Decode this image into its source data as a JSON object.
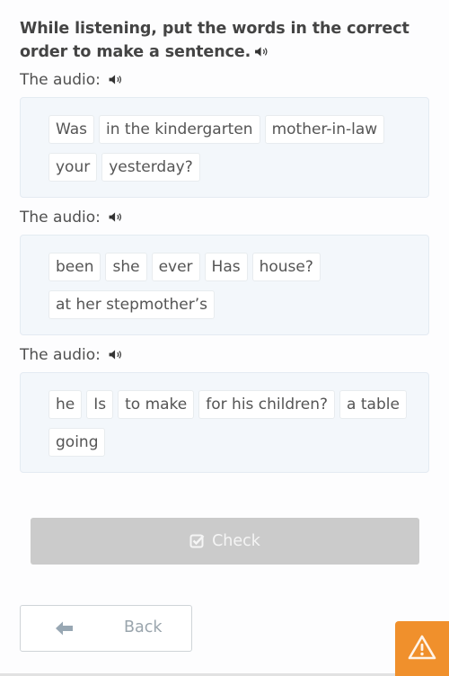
{
  "instruction": {
    "text": "While listening, put the words in the correct order to make a sentence.",
    "icon": "speaker-icon"
  },
  "exercises": [
    {
      "audio_label": "The audio:",
      "icon": "speaker-icon",
      "words": [
        "Was",
        "in the kindergarten",
        "mother-in-law",
        "your",
        "yesterday?"
      ]
    },
    {
      "audio_label": "The audio:",
      "icon": "speaker-icon",
      "words": [
        "been",
        "she",
        "ever",
        "Has",
        "house?",
        "at her stepmother’s"
      ]
    },
    {
      "audio_label": "The audio:",
      "icon": "speaker-icon",
      "words": [
        "he",
        "Is",
        "to make",
        "for his children?",
        "a table",
        "going"
      ]
    }
  ],
  "buttons": {
    "check_label": "Check",
    "check_icon": "checkbox-checked-icon",
    "back_label": "Back",
    "back_icon": "arrow-left-icon",
    "report_icon": "warning-icon"
  },
  "colors": {
    "check_disabled": "#cbcbcb",
    "warning": "#f0902c",
    "box_background": "#f3f7fb"
  }
}
